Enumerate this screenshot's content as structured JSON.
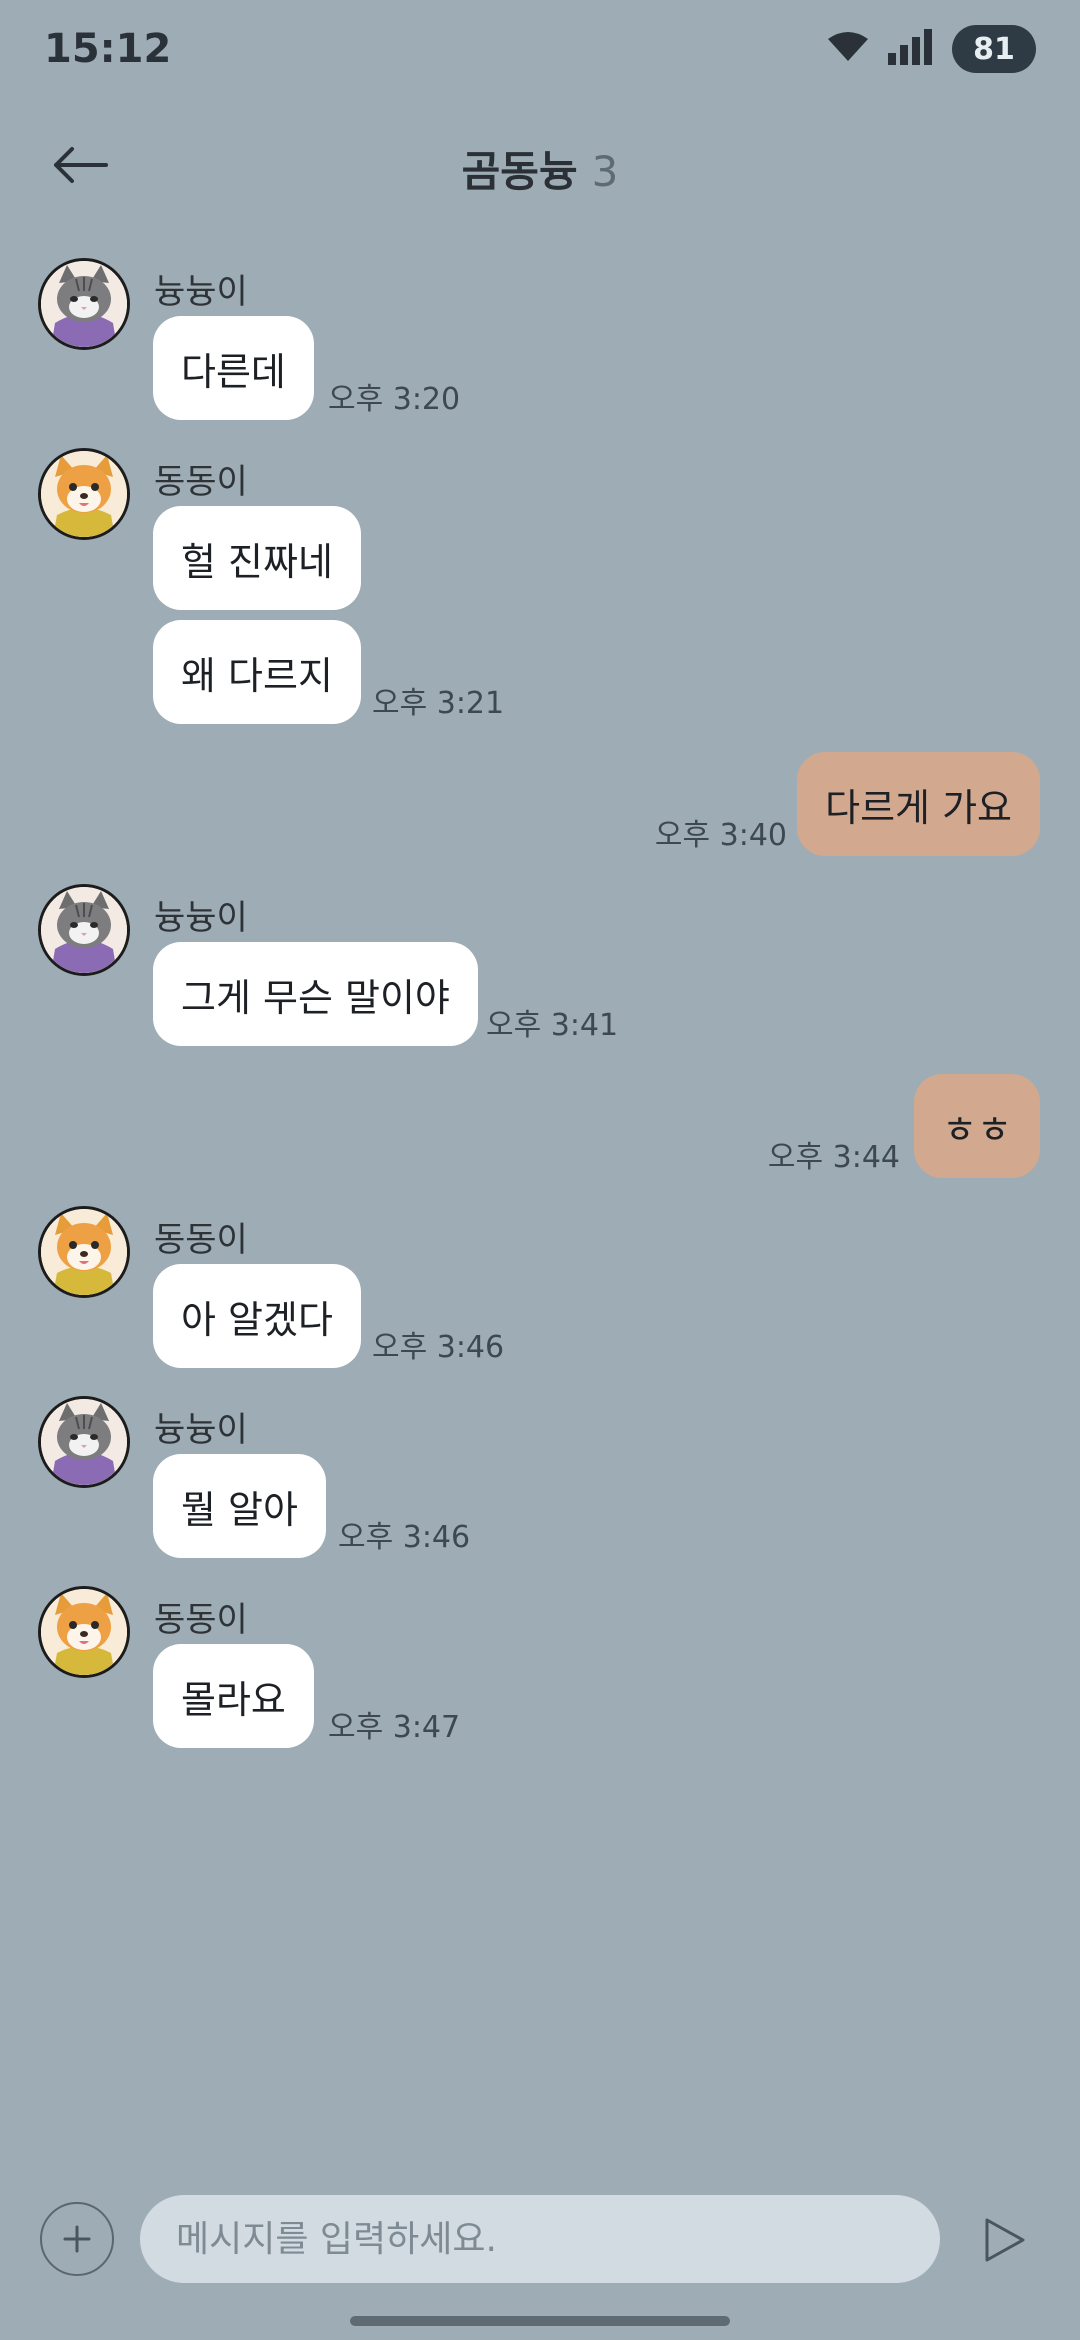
{
  "status_bar": {
    "time": "15:12",
    "battery": "81",
    "icons": [
      "wifi-icon",
      "cellular-signal-icon",
      "battery-icon"
    ]
  },
  "header": {
    "title": "곰동늉",
    "member_count": "3",
    "back_icon": "arrow-left-icon"
  },
  "messages": [
    {
      "direction": "in",
      "sender": "늉늉이",
      "avatar": "cat-avatar",
      "texts": [
        "다른데"
      ],
      "time": "오후 3:20"
    },
    {
      "direction": "in",
      "sender": "동동이",
      "avatar": "dog-avatar",
      "texts": [
        "헐 진짜네",
        "왜 다르지"
      ],
      "time": "오후 3:21"
    },
    {
      "direction": "out",
      "texts": [
        "다르게 가요"
      ],
      "time": "오후 3:40"
    },
    {
      "direction": "in",
      "sender": "늉늉이",
      "avatar": "cat-avatar",
      "texts": [
        "그게 무슨 말이야"
      ],
      "time": "오후 3:41"
    },
    {
      "direction": "out",
      "texts": [
        "ㅎㅎ"
      ],
      "time": "오후 3:44"
    },
    {
      "direction": "in",
      "sender": "동동이",
      "avatar": "dog-avatar",
      "texts": [
        "아 알겠다"
      ],
      "time": "오후 3:46"
    },
    {
      "direction": "in",
      "sender": "늉늉이",
      "avatar": "cat-avatar",
      "texts": [
        "뭘 알아"
      ],
      "time": "오후 3:46"
    },
    {
      "direction": "in",
      "sender": "동동이",
      "avatar": "dog-avatar",
      "texts": [
        "몰라요"
      ],
      "time": "오후 3:47"
    }
  ],
  "input_bar": {
    "placeholder": "메시지를 입력하세요.",
    "value": "",
    "plus_icon": "plus-icon",
    "send_icon": "send-icon"
  },
  "colors": {
    "background": "#9eacb5",
    "incoming_bubble": "#ffffff",
    "outgoing_bubble": "#d2a88e",
    "input_field": "#d2dbe1",
    "battery_pill": "#2e3a44"
  }
}
